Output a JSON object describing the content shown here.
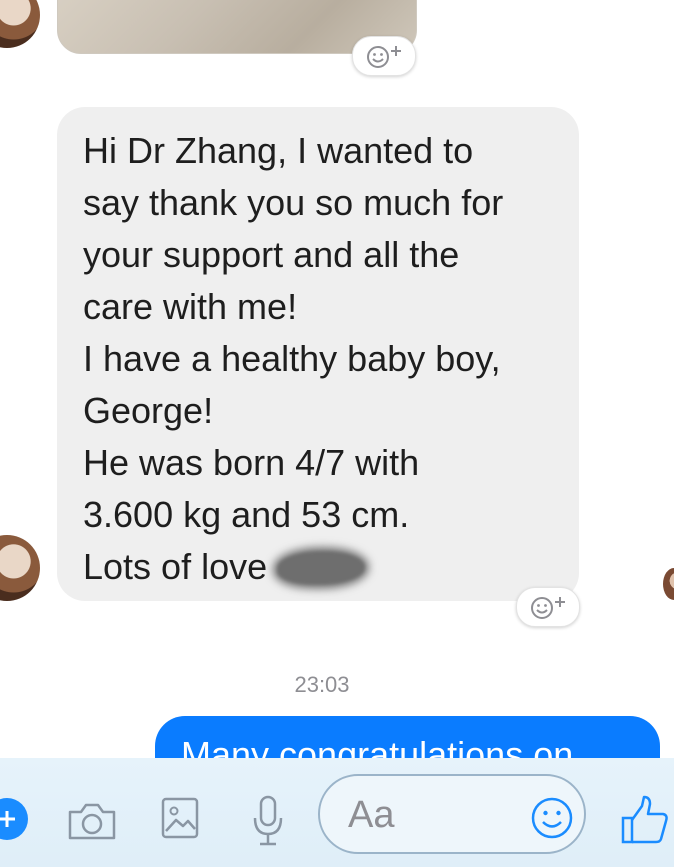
{
  "message_received": {
    "lines": [
      "Hi Dr Zhang, I wanted to",
      "say thank you so much for",
      "your support and all the",
      "care with me!",
      "I have a healthy baby boy,",
      "George!",
      "He was born 4/7 with",
      "3.600 kg and 53 cm.",
      "Lots of love"
    ]
  },
  "timestamp": "23:03",
  "message_sent": {
    "text": "Many congratulations on"
  },
  "composer": {
    "placeholder": "Aa"
  },
  "colors": {
    "received_bubble": "#efefef",
    "sent_bubble": "#0a7cff",
    "toolbar_background": "#e1f0f9",
    "accent": "#1a8cff"
  },
  "icons": {
    "reaction": "add-reaction-icon",
    "plus": "plus-icon",
    "camera": "camera-icon",
    "gallery": "gallery-icon",
    "microphone": "microphone-icon",
    "emoji": "emoji-icon",
    "like": "thumbs-up-icon"
  }
}
